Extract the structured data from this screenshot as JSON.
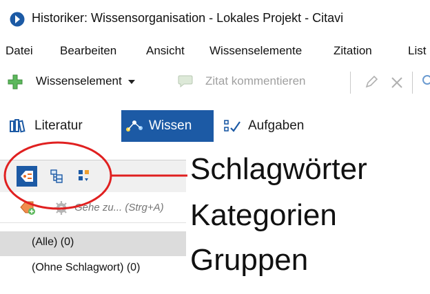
{
  "window": {
    "title": "Historiker: Wissensorganisation - Lokales Projekt - Citavi"
  },
  "menu": {
    "items": [
      "Datei",
      "Bearbeiten",
      "Ansicht",
      "Wissenselemente",
      "Zitation",
      "List"
    ]
  },
  "toolbar": {
    "new_element_label": "Wissenselement",
    "comment_label": "Zitat kommentieren"
  },
  "tabs": [
    {
      "label": "Literatur",
      "active": false
    },
    {
      "label": "Wissen",
      "active": true
    },
    {
      "label": "Aufgaben",
      "active": false
    }
  ],
  "panel": {
    "search_placeholder": "Gehe zu... (Strg+A)",
    "items": [
      {
        "label": "(Alle) (0)",
        "selected": true
      },
      {
        "label": "(Ohne Schlagwort) (0)",
        "selected": false
      }
    ]
  },
  "annotation": {
    "lines": [
      "Schlagwörter",
      "Kategorien",
      "Gruppen"
    ],
    "color": "#e02020"
  },
  "colors": {
    "accent": "#1c5aa5"
  }
}
